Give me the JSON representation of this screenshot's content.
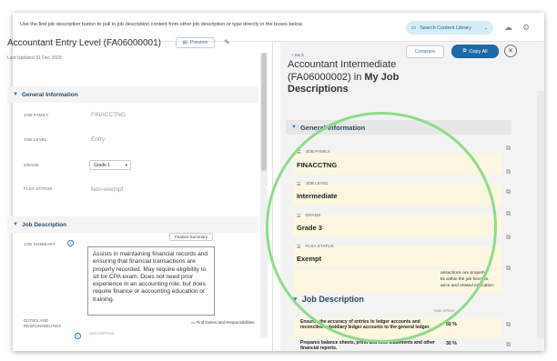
{
  "topbar": {
    "instruction": "Use the find job description button to pull in job description content from other job description or type directly in the boxes below.",
    "search_library_label": "Search Content Library",
    "search_library_chevron": "⌄",
    "top_icons": [
      "cloud-icon",
      "gear-icon"
    ]
  },
  "left": {
    "title": "Accountant Entry Level (FA06000001)",
    "preview_label": "Preview",
    "last_updated": "Last Updated 31 Dec 2020",
    "general_section": "General Information",
    "fields": [
      {
        "label": "JOB FAMILY",
        "value": "FINACCTNG"
      },
      {
        "label": "JOB LEVEL",
        "value": "Entry"
      },
      {
        "label": "GRADE",
        "value": "Grade 1"
      },
      {
        "label": "FLSA STATUS",
        "value": "Non-exempt"
      }
    ],
    "job_description_section": "Job Description",
    "job_summary_label": "JOB SUMMARY",
    "feature_summary_label": "Feature Summary",
    "summary_text": "Assists in maintaining financial records and ensuring that financial transactions are properly recorded. May require eligibility to sit for CPA exam. Does not need prior experience in an accounting role, but does require finance or accounting education or training.",
    "duties_label": "DUTIES AND RESPONSIBILITIES",
    "find_duties_label": "Find Duties and Responsibilities",
    "description_col": "DESCRIPTION"
  },
  "right": {
    "back_label": "< Back",
    "title_plain": "Accountant Intermediate (FA06000002) in ",
    "title_bold": "My Job Descriptions",
    "compare_label": "Compare",
    "copy_all_label": "Copy All",
    "general_section": "General Information",
    "fields": [
      {
        "label": "JOB FAMILY",
        "value": "FINACCTNG"
      },
      {
        "label": "JOB LEVEL",
        "value": "Intermediate"
      },
      {
        "label": "GRADE",
        "value": "Grade 3"
      },
      {
        "label": "FLSA STATUS",
        "value": "Exempt"
      }
    ],
    "summary_snippet_1": "ansactions are properly",
    "summary_snippet_2": "ks within the job function,",
    "summary_snippet_3": "ance and related education.",
    "job_description_section": "Job Description",
    "time_spent_label": "TIME SPENT",
    "responsibilities": [
      {
        "text": "Ensures the accuracy of entries to ledger accounts and reconciles subsidiary ledger accounts to the general ledger.",
        "pct": "50 %"
      },
      {
        "text": "Prepares balance sheets, profit and loss statements and other financial reports.",
        "pct": "30 %"
      }
    ]
  },
  "colors": {
    "accent_blue": "#1e6aa6",
    "highlight_circle": "#8fdb8a",
    "highlight_row": "#fbf7e0"
  }
}
